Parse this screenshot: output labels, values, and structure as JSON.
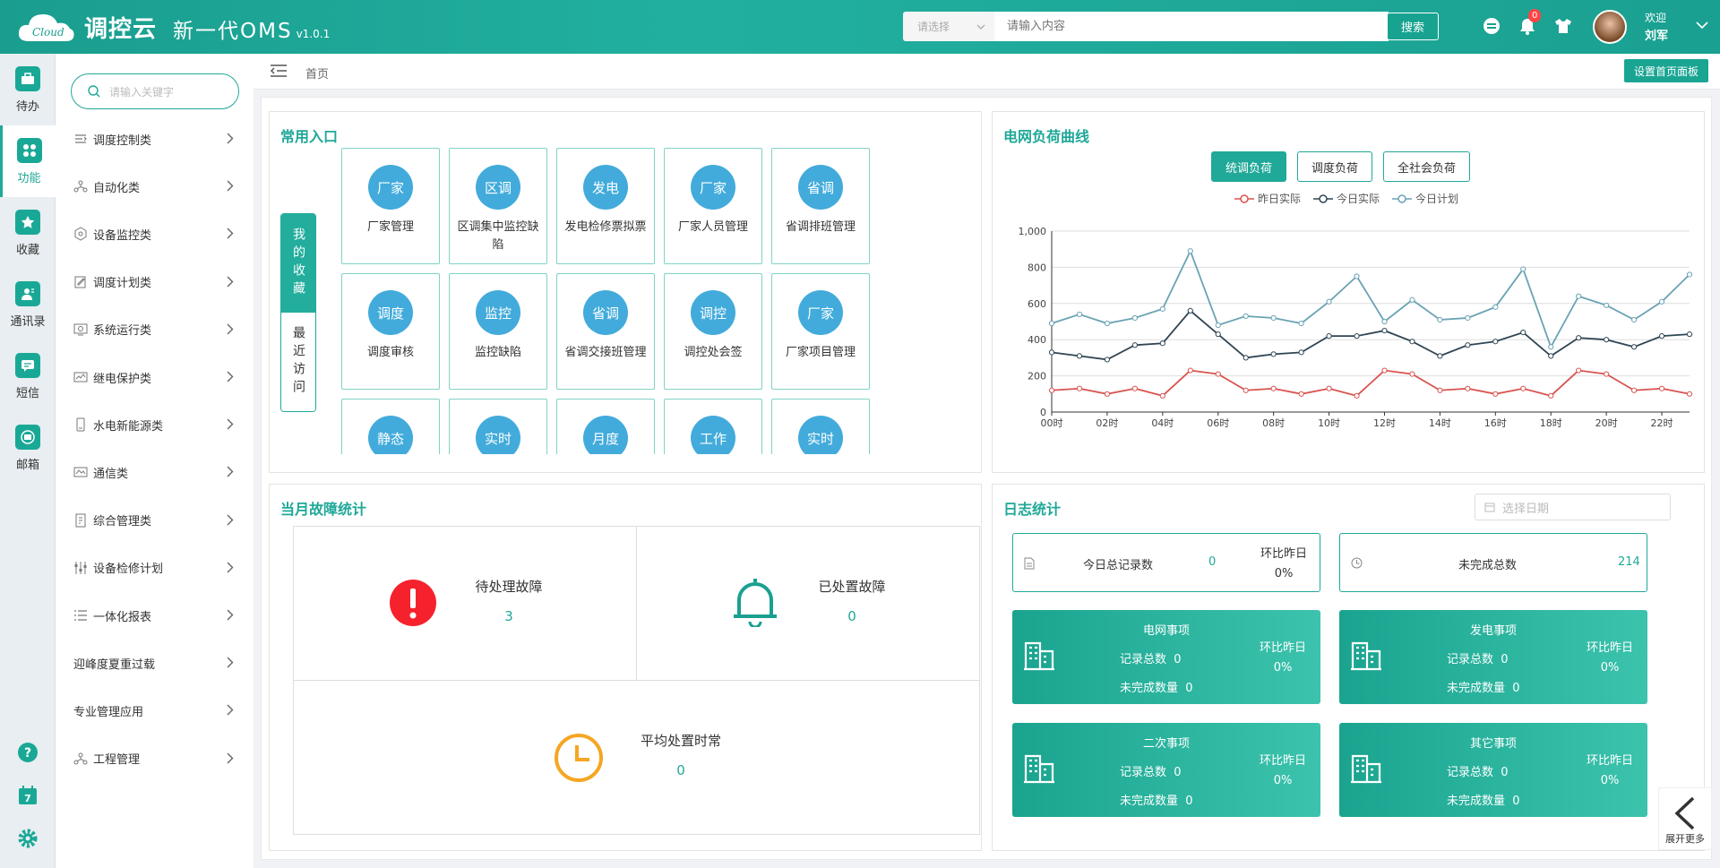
{
  "header": {
    "logo_text": "调控云",
    "logo_cloud_text": "Cloud",
    "app_title": "新一代OMS",
    "version": "v1.0.1",
    "search_select_placeholder": "请选择",
    "search_placeholder": "请输入内容",
    "search_button": "搜索",
    "notification_count": "0",
    "welcome": "欢迎",
    "user_name": "刘军"
  },
  "rail": {
    "items": [
      {
        "label": "待办",
        "icon": "briefcase-icon"
      },
      {
        "label": "功能",
        "icon": "apps-icon"
      },
      {
        "label": "收藏",
        "icon": "star-icon"
      },
      {
        "label": "通讯录",
        "icon": "contacts-icon"
      },
      {
        "label": "短信",
        "icon": "message-icon"
      },
      {
        "label": "邮箱",
        "icon": "mail-icon"
      }
    ],
    "calendar_day": "7"
  },
  "sidebar": {
    "search_placeholder": "请输入关键字",
    "items": [
      {
        "label": "调度控制类"
      },
      {
        "label": "自动化类"
      },
      {
        "label": "设备监控类"
      },
      {
        "label": "调度计划类"
      },
      {
        "label": "系统运行类"
      },
      {
        "label": "继电保护类"
      },
      {
        "label": "水电新能源类"
      },
      {
        "label": "通信类"
      },
      {
        "label": "综合管理类"
      },
      {
        "label": "设备检修计划"
      },
      {
        "label": "一体化报表"
      },
      {
        "label": "迎峰度夏重过载"
      },
      {
        "label": "专业管理应用"
      },
      {
        "label": "工程管理"
      }
    ]
  },
  "topbar": {
    "breadcrumb": "首页",
    "set_panel_button": "设置首页面板"
  },
  "common": {
    "title": "常用入口",
    "tab_favorites": "我的收藏",
    "tab_recent": "最近访问",
    "tiles": [
      {
        "badge": "厂家",
        "label": "厂家管理"
      },
      {
        "badge": "区调",
        "label": "区调集中监控缺陷"
      },
      {
        "badge": "发电",
        "label": "发电检修票拟票"
      },
      {
        "badge": "厂家",
        "label": "厂家人员管理"
      },
      {
        "badge": "省调",
        "label": "省调排班管理"
      },
      {
        "badge": "调度",
        "label": "调度审核"
      },
      {
        "badge": "监控",
        "label": "监控缺陷"
      },
      {
        "badge": "省调",
        "label": "省调交接班管理"
      },
      {
        "badge": "调控",
        "label": "调控处会签"
      },
      {
        "badge": "厂家",
        "label": "厂家项目管理"
      },
      {
        "badge": "静态",
        "label": ""
      },
      {
        "badge": "实时",
        "label": ""
      },
      {
        "badge": "月度",
        "label": ""
      },
      {
        "badge": "工作",
        "label": ""
      },
      {
        "badge": "实时",
        "label": ""
      }
    ]
  },
  "load": {
    "title": "电网负荷曲线",
    "tabs": [
      "统调负荷",
      "调度负荷",
      "全社会负荷"
    ],
    "active_tab": 0
  },
  "chart_data": {
    "type": "line",
    "x": [
      "00时",
      "01时",
      "02时",
      "03时",
      "04时",
      "05时",
      "06时",
      "07时",
      "08时",
      "09时",
      "10时",
      "11时",
      "12时",
      "13时",
      "14时",
      "15时",
      "16时",
      "17时",
      "18时",
      "19时",
      "20时",
      "21时",
      "22时",
      "23时"
    ],
    "xticks": [
      "00时",
      "02时",
      "04时",
      "06时",
      "08时",
      "10时",
      "12时",
      "14时",
      "16时",
      "18时",
      "20时",
      "22时"
    ],
    "ylim": [
      0,
      1000
    ],
    "yticks": [
      "0",
      "200",
      "400",
      "600",
      "800",
      "1,000"
    ],
    "grid": true,
    "legend_position": "top-center",
    "series": [
      {
        "name": "昨日实际",
        "color": "#d9534f",
        "values": [
          120,
          130,
          100,
          130,
          90,
          230,
          210,
          120,
          130,
          100,
          130,
          90,
          230,
          210,
          120,
          130,
          100,
          130,
          90,
          230,
          210,
          120,
          130,
          100
        ]
      },
      {
        "name": "今日实际",
        "color": "#2f4554",
        "values": [
          330,
          310,
          290,
          370,
          380,
          560,
          430,
          300,
          320,
          330,
          420,
          420,
          450,
          390,
          310,
          370,
          390,
          440,
          310,
          410,
          400,
          360,
          420,
          430
        ]
      },
      {
        "name": "今日计划",
        "color": "#6aa3b4",
        "values": [
          490,
          540,
          490,
          520,
          570,
          890,
          480,
          530,
          520,
          490,
          610,
          750,
          500,
          620,
          510,
          520,
          580,
          790,
          360,
          640,
          590,
          510,
          610,
          760
        ]
      }
    ]
  },
  "faults": {
    "title": "当月故障统计",
    "pending_label": "待处理故障",
    "pending_value": "3",
    "handled_label": "已处置故障",
    "handled_value": "0",
    "avg_label": "平均处置时常",
    "avg_value": "0"
  },
  "logs": {
    "title": "日志统计",
    "date_placeholder": "选择日期",
    "today_total_label": "今日总记录数",
    "today_total_value": "0",
    "compare_label": "环比昨日",
    "compare_value": "0%",
    "unfinished_label": "未完成总数",
    "unfinished_value": "214",
    "events": [
      {
        "title": "电网事项",
        "total_label": "记录总数",
        "total": "0",
        "unfinished_label": "未完成数量",
        "unfinished": "0",
        "compare_label": "环比昨日",
        "compare": "0%"
      },
      {
        "title": "发电事项",
        "total_label": "记录总数",
        "total": "0",
        "unfinished_label": "未完成数量",
        "unfinished": "0",
        "compare_label": "环比昨日",
        "compare": "0%"
      },
      {
        "title": "二次事项",
        "total_label": "记录总数",
        "total": "0",
        "unfinished_label": "未完成数量",
        "unfinished": "0",
        "compare_label": "环比昨日",
        "compare": "0%"
      },
      {
        "title": "其它事项",
        "total_label": "记录总数",
        "total": "0",
        "unfinished_label": "未完成数量",
        "unfinished": "0",
        "compare_label": "环比昨日",
        "compare": "0%"
      }
    ]
  },
  "more_button": "展开更多"
}
